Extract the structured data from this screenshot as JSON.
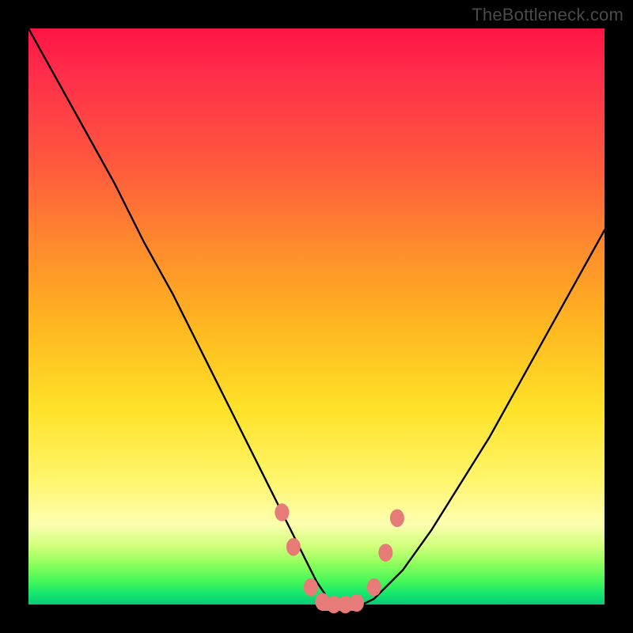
{
  "watermark": {
    "text": "TheBottleneck.com"
  },
  "chart_data": {
    "type": "line",
    "title": "",
    "xlabel": "",
    "ylabel": "",
    "xlim": [
      0,
      100
    ],
    "ylim": [
      0,
      100
    ],
    "grid": false,
    "legend": false,
    "series": [
      {
        "name": "curve",
        "x": [
          0,
          5,
          10,
          15,
          20,
          25,
          30,
          35,
          40,
          45,
          48,
          50,
          52,
          54,
          56,
          58,
          60,
          65,
          70,
          75,
          80,
          85,
          90,
          95,
          100
        ],
        "y": [
          100,
          91,
          82,
          73,
          63,
          54,
          44,
          34,
          24,
          14,
          8,
          4,
          1,
          0,
          0,
          0,
          1,
          6,
          13,
          21,
          29,
          38,
          47,
          56,
          65
        ]
      }
    ],
    "markers": [
      {
        "name": "pink-dots",
        "color": "#e77b77",
        "points": [
          {
            "x": 44,
            "y": 16
          },
          {
            "x": 46,
            "y": 10
          },
          {
            "x": 49,
            "y": 3
          },
          {
            "x": 51,
            "y": 0.5
          },
          {
            "x": 53,
            "y": 0
          },
          {
            "x": 55,
            "y": 0
          },
          {
            "x": 57,
            "y": 0.3
          },
          {
            "x": 60,
            "y": 3
          },
          {
            "x": 62,
            "y": 9
          },
          {
            "x": 64,
            "y": 15
          }
        ],
        "radius": 9
      }
    ],
    "flat_segment": {
      "name": "pink-bar",
      "color": "#e77b77",
      "y": 0,
      "x_start": 50,
      "x_end": 58,
      "thickness": 16
    },
    "background_gradient": {
      "stops": [
        {
          "pos": 0,
          "color": "#ff1444"
        },
        {
          "pos": 24,
          "color": "#ff5a3c"
        },
        {
          "pos": 52,
          "color": "#ffb820"
        },
        {
          "pos": 78,
          "color": "#fff56a"
        },
        {
          "pos": 93,
          "color": "#8dff5c"
        },
        {
          "pos": 100,
          "color": "#08c978"
        }
      ]
    }
  }
}
